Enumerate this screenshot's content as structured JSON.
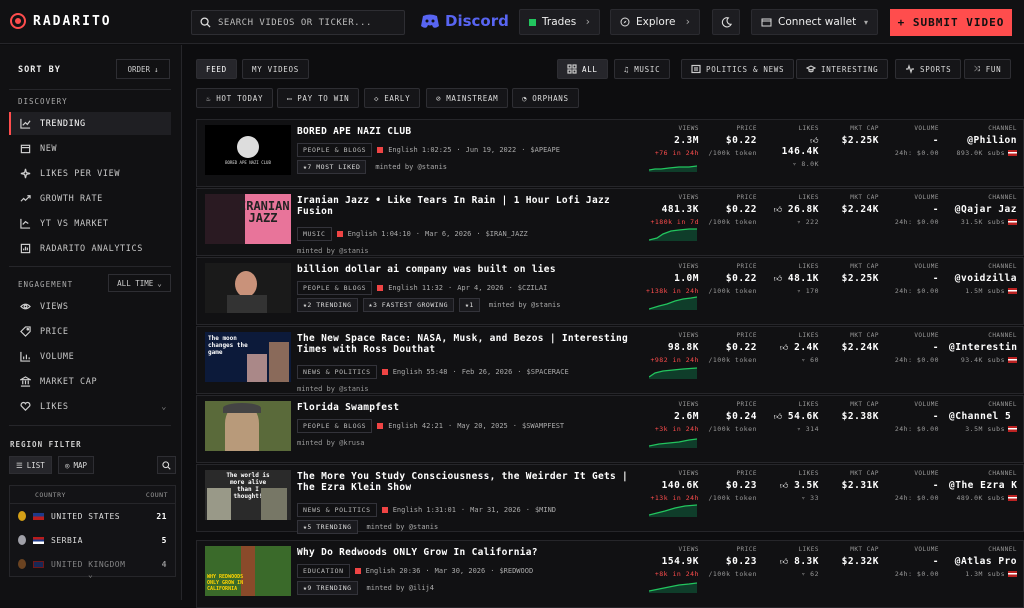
{
  "app": {
    "logo_text": "RADARITO"
  },
  "topbar": {
    "search_placeholder": "SEARCH VIDEOS OR TICKER...",
    "discord_label": "Discord",
    "trades_label": "Trades",
    "explore_label": "Explore",
    "connect_label": "Connect wallet",
    "submit_label": "+ SUBMIT VIDEO"
  },
  "sidebar": {
    "sort_by": "SORT BY",
    "order_label": "ORDER",
    "discovery_label": "DISCOVERY",
    "discovery_items": [
      "TRENDING",
      "NEW",
      "LIKES PER VIEW",
      "GROWTH RATE",
      "YT VS MARKET",
      "RADARITO ANALYTICS"
    ],
    "engagement_label": "ENGAGEMENT",
    "alltime_label": "ALL TIME",
    "engagement_items": [
      "VIEWS",
      "PRICE",
      "VOLUME",
      "MARKET CAP",
      "LIKES"
    ],
    "region_label": "REGION FILTER",
    "list_label": "LIST",
    "map_label": "MAP",
    "country_header": "COUNTRY",
    "count_header": "COUNT",
    "regions": [
      {
        "name": "UNITED STATES",
        "count": "21"
      },
      {
        "name": "SERBIA",
        "count": "5"
      },
      {
        "name": "UNITED KINGDOM",
        "count": "4"
      }
    ]
  },
  "main": {
    "tabs": [
      "FEED",
      "MY VIDEOS"
    ],
    "categories": [
      "ALL",
      "MUSIC",
      "POLITICS & NEWS",
      "INTERESTING",
      "SPORTS",
      "FUN"
    ],
    "filters": [
      "HOT TODAY",
      "PAY TO WIN",
      "EARLY",
      "MAINSTREAM",
      "ORPHANS"
    ],
    "col_labels": {
      "views": "VIEWS",
      "price": "PRICE",
      "likes": "LIKES",
      "mcap": "MKT CAP",
      "volume": "VOLUME",
      "channel": "CHANNEL"
    },
    "price_unit": "/100k token",
    "videos": [
      {
        "title": "BORED APE NAZI CLUB",
        "category": "PEOPLE & BLOGS",
        "lang": "English 1:02:25",
        "date": "Jun 19, 2022",
        "ticker": "$APEAPE",
        "badges": [
          "★7 MOST LIKED"
        ],
        "minted": "minted by @stanis",
        "views": "2.3M",
        "growth": "+76 in 24h",
        "price": "$0.22",
        "likes": "146.4K",
        "dislikes": "8.0K",
        "mcap": "$2.25K",
        "volume_a": "-",
        "volume_b": "24h: $0.00",
        "channel": "@Philion",
        "subs": "893.0K subs"
      },
      {
        "title": "Iranian Jazz • Like Tears In Rain | 1 Hour Lofi Jazz Fusion",
        "category": "MUSIC",
        "lang": "English 1:04:10",
        "date": "Mar 6, 2026",
        "ticker": "$IRAN_JAZZ",
        "badges": [],
        "minted": "minted by @stanis",
        "views": "481.3K",
        "growth": "+180k in 7d",
        "price": "$0.22",
        "likes": "26.8K",
        "dislikes": "222",
        "mcap": "$2.24K",
        "volume_a": "-",
        "volume_b": "24h: $0.00",
        "channel": "@Qajar Jaz",
        "subs": "31.5K subs"
      },
      {
        "title": "billion dollar ai company was built on lies",
        "category": "PEOPLE & BLOGS",
        "lang": "English 11:32",
        "date": "Apr 4, 2026",
        "ticker": "$CZILAI",
        "badges": [
          "★2 TRENDING",
          "★3 FASTEST GROWING",
          "★1"
        ],
        "minted": "minted by @stanis",
        "views": "1.0M",
        "growth": "+138k in 24h",
        "price": "$0.22",
        "likes": "48.1K",
        "dislikes": "170",
        "mcap": "$2.25K",
        "volume_a": "-",
        "volume_b": "24h: $0.00",
        "channel": "@voidzilla",
        "subs": "1.5M subs"
      },
      {
        "title": "The New Space Race: NASA, Musk, and Bezos | Interesting Times with Ross Douthat",
        "category": "NEWS & POLITICS",
        "lang": "English 55:48",
        "date": "Feb 26, 2026",
        "ticker": "$SPACERACE",
        "badges": [],
        "minted": "minted by @stanis",
        "views": "98.8K",
        "growth": "+982 in 24h",
        "price": "$0.22",
        "likes": "2.4K",
        "dislikes": "60",
        "mcap": "$2.24K",
        "volume_a": "-",
        "volume_b": "24h: $0.00",
        "channel": "@Interestin…",
        "subs": "93.4K subs"
      },
      {
        "title": "Florida Swampfest",
        "category": "PEOPLE & BLOGS",
        "lang": "English 42:21",
        "date": "May 20, 2025",
        "ticker": "$SWAMPFEST",
        "badges": [],
        "minted": "minted by @krusa",
        "views": "2.6M",
        "growth": "+3k in 24h",
        "price": "$0.24",
        "likes": "54.6K",
        "dislikes": "314",
        "mcap": "$2.38K",
        "volume_a": "-",
        "volume_b": "24h: $0.00",
        "channel": "@Channel 5 …",
        "subs": "3.5M subs"
      },
      {
        "title": "The More You Study Consciousness, the Weirder It Gets | The Ezra Klein Show",
        "category": "NEWS & POLITICS",
        "lang": "English 1:31:01",
        "date": "Mar 31, 2026",
        "ticker": "$MIND",
        "badges": [
          "★5 TRENDING"
        ],
        "minted": "minted by @stanis",
        "views": "140.6K",
        "growth": "+13k in 24h",
        "price": "$0.23",
        "likes": "3.5K",
        "dislikes": "33",
        "mcap": "$2.31K",
        "volume_a": "-",
        "volume_b": "24h: $0.00",
        "channel": "@The Ezra K…",
        "subs": "489.0K subs"
      },
      {
        "title": "Why Do Redwoods ONLY Grow In California?",
        "category": "EDUCATION",
        "lang": "English 20:36",
        "date": "Mar 30, 2026",
        "ticker": "$REDWOOD",
        "badges": [
          "★9 TRENDING"
        ],
        "minted": "minted by @ilij4",
        "views": "154.9K",
        "growth": "+8k in 24h",
        "price": "$0.23",
        "likes": "8.3K",
        "dislikes": "62",
        "mcap": "$2.32K",
        "volume_a": "-",
        "volume_b": "24h: $0.00",
        "channel": "@Atlas Pro",
        "subs": "1.3M subs"
      }
    ],
    "thumbs": {
      "t1_text": "BORED APE NAZI CLUB",
      "t2_text": "IRANIAN JAZZ",
      "t4_text": "The moon changes the game",
      "t6_text": "The world is more alive than I thought!",
      "t7_text": "WHY REDWOODS ONLY GROW IN CALIFORNIA"
    }
  },
  "colors": {
    "accent": "#ff4d4d",
    "discord": "#5865f2",
    "green": "#22c55e"
  }
}
